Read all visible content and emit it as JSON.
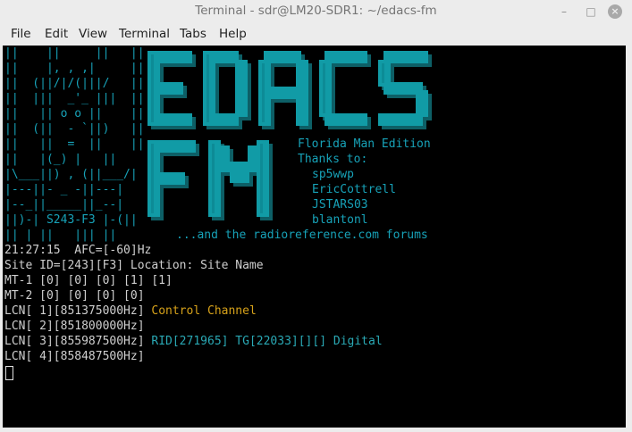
{
  "window": {
    "title": "Terminal - sdr@LM20-SDR1: ~/edacs-fm",
    "minimize": "–",
    "maximize": "□",
    "close": "×"
  },
  "menu": [
    "File",
    "Edit",
    "View",
    "Terminal",
    "Tabs",
    "Help"
  ],
  "colors": {
    "logo_fill": "#119ba6",
    "logo_shadow": "#0d5f66",
    "logo_text": "#17a2b8",
    "control_channel": "#d7a21a",
    "digital_call": "#2aa9b5"
  },
  "banner": {
    "ascii_art": [
      "||    ||     ||   ||",
      "||    |, , ,|     ||",
      "||  (||/|/(|||/   ||",
      "||  |||  _'_ |||  ||",
      "||   || o o ||    ||",
      "||  (||  - `||)   ||",
      "||   ||  =  ||    ||",
      "||   |(_) |   ||",
      "|\\___||) , (||___/|",
      "|---||- _ -||---|",
      "|--_||_____||_--|",
      "||)-| S243-F3 |-(||",
      "|| | ||   ||| ||"
    ],
    "logo_words": [
      "EDACS",
      "FM"
    ],
    "edition": "Florida Man Edition",
    "thanks_label": "Thanks to:",
    "credits": [
      "sp5wwp",
      "EricCottrell",
      "JSTARS03",
      "blantonl"
    ],
    "footer": "...and the radioreference.com forums"
  },
  "status": {
    "time_afc": "21:27:15  AFC=[-60]Hz",
    "site": "Site ID=[243][F3] Location: Site Name",
    "mt1": "MT-1 [0] [0] [0] [1] [1]",
    "mt2": "MT-2 [0] [0] [0] [0]"
  },
  "lcn": [
    {
      "label": "LCN[ 1][851375000Hz]",
      "info": "Control Channel"
    },
    {
      "label": "LCN[ 2][851800000Hz]",
      "info": ""
    },
    {
      "label": "LCN[ 3][855987500Hz]",
      "info": "RID[271965] TG[22033][][] Digital"
    },
    {
      "label": "LCN[ 4][858487500Hz]",
      "info": ""
    }
  ]
}
